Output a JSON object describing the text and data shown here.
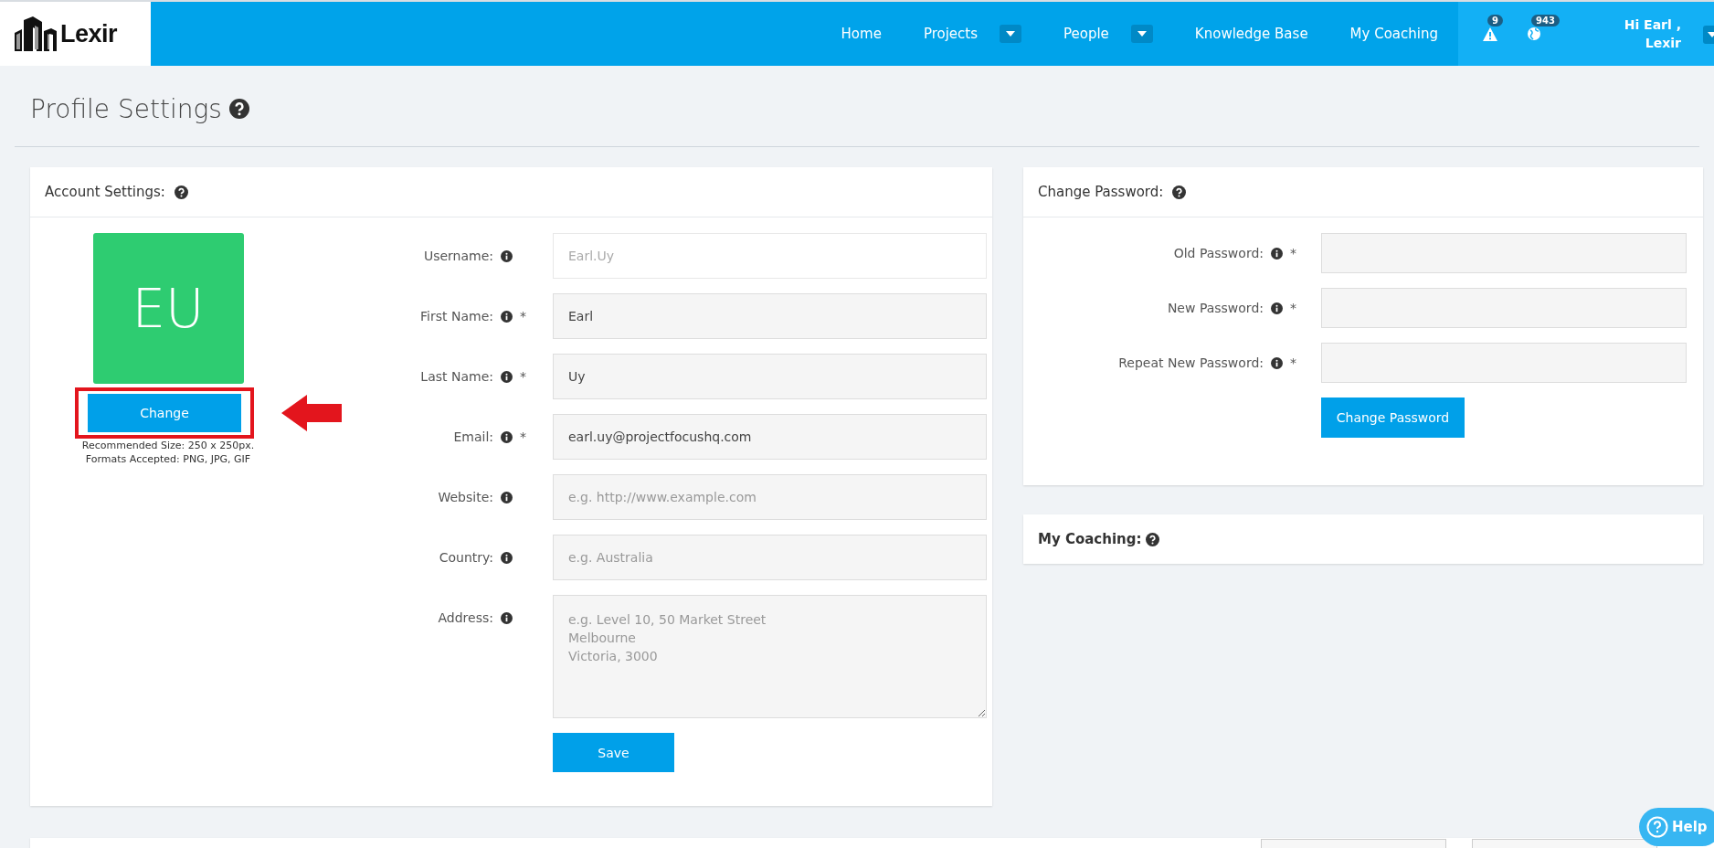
{
  "logo": {
    "text": "Lexir"
  },
  "nav": [
    {
      "label": "Home",
      "dropdown": false
    },
    {
      "label": "Projects",
      "dropdown": true
    },
    {
      "label": "People",
      "dropdown": true
    },
    {
      "label": "Knowledge Base",
      "dropdown": false
    },
    {
      "label": "My Coaching",
      "dropdown": false
    }
  ],
  "alerts": [
    {
      "kind": "warning",
      "count": "9"
    },
    {
      "kind": "globe",
      "count": "943"
    }
  ],
  "user": {
    "greeting": "Hi Earl ,",
    "org": "Lexir"
  },
  "page_title": "Profile Settings",
  "account": {
    "title": "Account Settings:",
    "avatar_initials": "EU",
    "change_button": "Change",
    "highlighted": true,
    "hint_lines": [
      "Recommended Size: 250 x 250px.",
      "Formats Accepted: PNG, JPG, GIF"
    ],
    "fields": [
      {
        "label": "Username:",
        "disabled": true,
        "value": "Earl.Uy"
      },
      {
        "label": "First Name:",
        "required_mark": "*",
        "disabled": false,
        "value": "Earl"
      },
      {
        "label": "Last Name:",
        "required_mark": "*",
        "disabled": false,
        "value": "Uy"
      },
      {
        "label": "Email:",
        "required_mark": "*",
        "disabled": false,
        "value": "earl.uy@projectfocushq.com"
      },
      {
        "label": "Website:",
        "disabled": false,
        "placeholder": "e.g. http://www.example.com"
      },
      {
        "label": "Country:",
        "disabled": false,
        "placeholder": "e.g. Australia"
      },
      {
        "label": "Address:",
        "disabled": false,
        "kind": "multiline",
        "placeholder": "e.g. Level 10, 50 Market Street\nMelbourne\nVictoria, 3000"
      }
    ],
    "save_button": "Save"
  },
  "password": {
    "title": "Change Password:",
    "fields": [
      {
        "label": "Old Password:",
        "required_mark": "*"
      },
      {
        "label": "New Password:",
        "required_mark": "*"
      },
      {
        "label": "Repeat New Password:",
        "required_mark": "*"
      }
    ],
    "button": "Change Password"
  },
  "coaching": {
    "title": "My Coaching:"
  },
  "help_button": "Help"
}
